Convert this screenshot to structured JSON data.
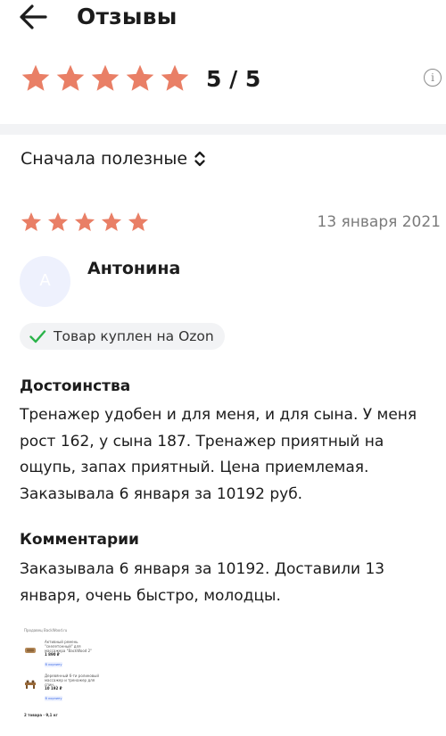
{
  "header": {
    "title": "Отзывы",
    "back_icon": "arrow-left-icon"
  },
  "rating": {
    "stars_filled": 5,
    "stars_total": 5,
    "score_text": "5 / 5",
    "star_color": "#e97f66",
    "info_icon_text": "i"
  },
  "sort": {
    "label": "Сначала полезные",
    "icon": "chevron-up-down-icon"
  },
  "review": {
    "stars_filled": 5,
    "date": "13 января 2021",
    "avatar_letter": "А",
    "author": "Антонина",
    "badge": "Товар куплен на Ozon",
    "badge_icon": "check-icon",
    "badge_icon_color": "#2bb34a",
    "pros_title": "Достоинства",
    "pros_text": "Тренажер удобен и для меня, и для сына. У меня рост 162, у сына 187. Тренажер приятный на ощупь, запах приятный. Цена приемлемая. Заказывала 6 января за 10192 руб.",
    "comment_title": "Комментарии",
    "comment_text": "Заказывала 6 января за 10192. Доставили 13 января, очень быстро, молодцы.",
    "photo": {
      "seller": "Продавец BackWood.ru",
      "items": [
        {
          "name": "Активный ремень \"скелетонный\" для массажера \"BackWood 2\"",
          "price": "1 890 ₽",
          "button": "В корзину"
        },
        {
          "name": "Деревянный 6-ти роликовый массажер и тренажер для спин...",
          "price": "10 192 ₽",
          "button": "В корзину"
        }
      ],
      "footer": "2 товара · 9,1 кг"
    }
  }
}
